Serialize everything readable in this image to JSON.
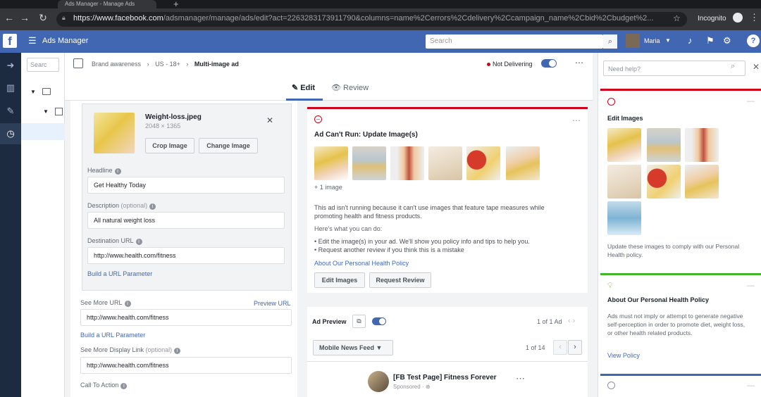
{
  "browser": {
    "tab_title": "Ads Manager - Manage Ads",
    "url_domain": "https://www.facebook.com",
    "url_path": "/adsmanager/manage/ads/edit?act=226328317391179​0&columns=name%2Cerrors%2Cdelivery%2Ccampaign_name%2Cbid%2Cbudget%2...",
    "profile_label": "Incognito"
  },
  "fb": {
    "logo": "f",
    "app_title": "Ads Manager",
    "search_placeholder": "Search",
    "user_name": "Maria"
  },
  "tree": {
    "search_placeholder": "Searc"
  },
  "breadcrumb": {
    "campaign": "Brand awareness",
    "adset": "US - 18+",
    "ad": "Multi-image ad",
    "sep": "›"
  },
  "status": {
    "label": "Not Delivering"
  },
  "tabs": {
    "edit": "Edit",
    "review": "Review"
  },
  "creative": {
    "file_name": "Weight-loss.jpeg",
    "dimensions": "2048 × 1365",
    "crop_label": "Crop Image",
    "change_label": "Change Image"
  },
  "form": {
    "headline_label": "Headline",
    "headline_value": "Get Healthy Today",
    "description_label": "Description",
    "optional": "(optional)",
    "description_value": "All natural weight loss",
    "destination_label": "Destination URL",
    "destination_value": "http://www.health.com/fitness",
    "build_param": "Build a URL Parameter",
    "see_more_label": "See More URL",
    "preview_url": "Preview URL",
    "see_more_value": "http://www.health.com/fitness",
    "build_param2": "Build a URL Parameter",
    "display_link_label": "See More Display Link",
    "display_link_value": "http://www.health.com/fitness",
    "cta_label": "Call To Action"
  },
  "rejection": {
    "title": "Ad Can't Run: Update Image(s)",
    "more_images": "+ 1 image",
    "body": "This ad isn't running because it can't use images that feature tape measures while promoting health and fitness products.",
    "help_intro": "Here's what you can do:",
    "bullet1": "Edit the image(s) in your ad. We'll show you policy info and tips to help you.",
    "bullet2": "Request another review if you think this is a mistake",
    "policy_link": "About Our Personal Health Policy",
    "edit_images_btn": "Edit Images",
    "request_review_btn": "Request Review"
  },
  "preview": {
    "label": "Ad Preview",
    "count": "1 of 1 Ad",
    "placement": "Mobile News Feed",
    "page_count": "1 of 14",
    "page_name": "[FB Test Page] Fitness Forever",
    "sponsored": "Sponsored"
  },
  "help": {
    "search_placeholder": "Need help?",
    "card1_title": "Edit Images",
    "card1_body": "Update these images to comply with our Personal Health policy.",
    "card2_title": "About Our Personal Health Policy",
    "card2_body": "Ads must not imply or attempt to generate negative self-perception in order to promote diet, weight loss, or other health related products.",
    "card2_link": "View Policy"
  }
}
